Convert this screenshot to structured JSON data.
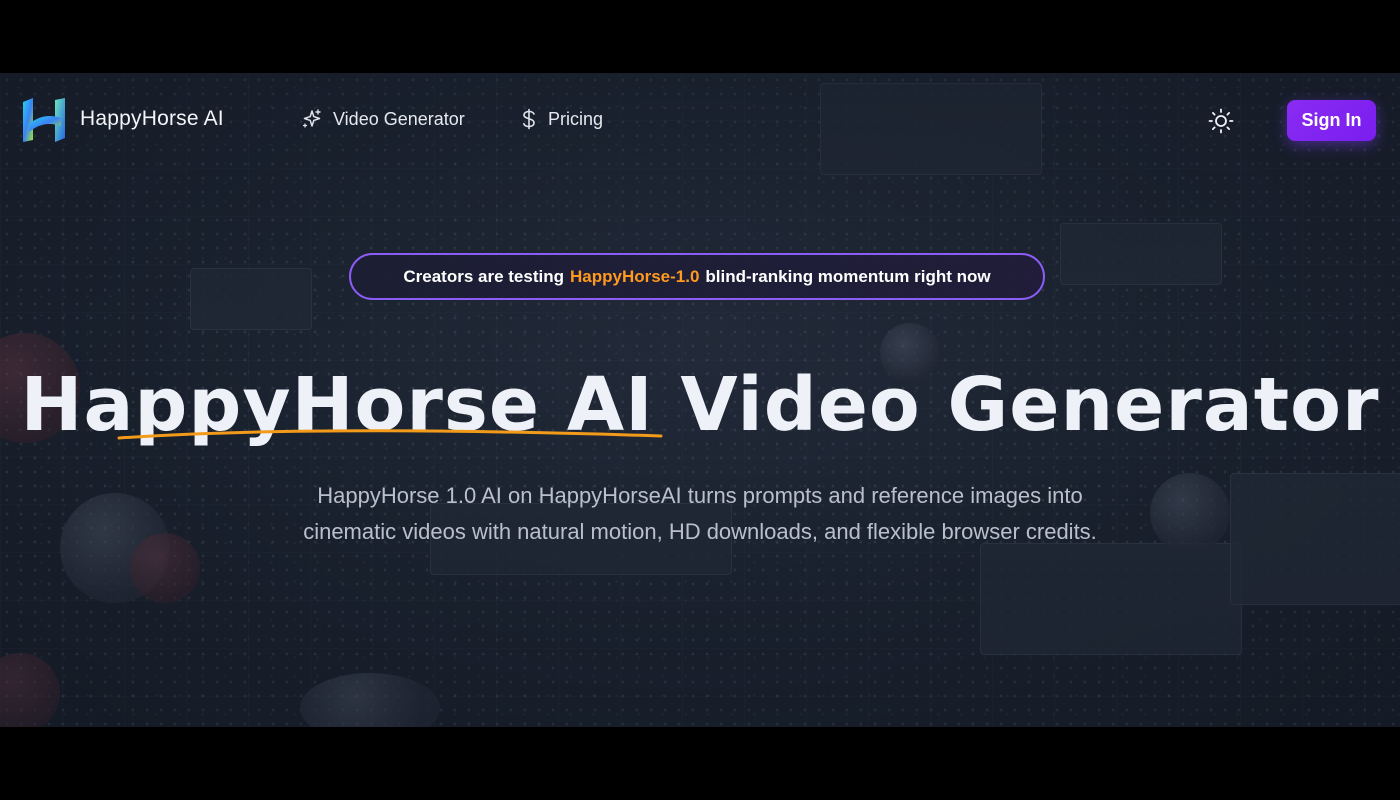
{
  "header": {
    "brand_name": "HappyHorse AI",
    "nav": [
      {
        "label": "Video Generator",
        "icon": "sparkles-icon"
      },
      {
        "label": "Pricing",
        "icon": "dollar-icon"
      }
    ],
    "theme_toggle_icon": "sun-icon",
    "sign_in_label": "Sign In"
  },
  "announcement": {
    "prefix": "Creators are testing",
    "highlight": "HappyHorse-1.0",
    "suffix": "blind-ranking momentum right now",
    "highlight_color": "#ff9a1f",
    "border_color": "#8b5cf6"
  },
  "hero": {
    "title_brand": "HappyHorse AI",
    "title_rest": "Video Generator",
    "subtitle_line1": "HappyHorse 1.0 AI on HappyHorseAI turns prompts and reference images into",
    "subtitle_line2": "cinematic videos with natural motion, HD downloads, and flexible browser credits."
  },
  "colors": {
    "accent": "#7a1ef0",
    "underline": "#f29a1a",
    "background": "#1c2431"
  }
}
